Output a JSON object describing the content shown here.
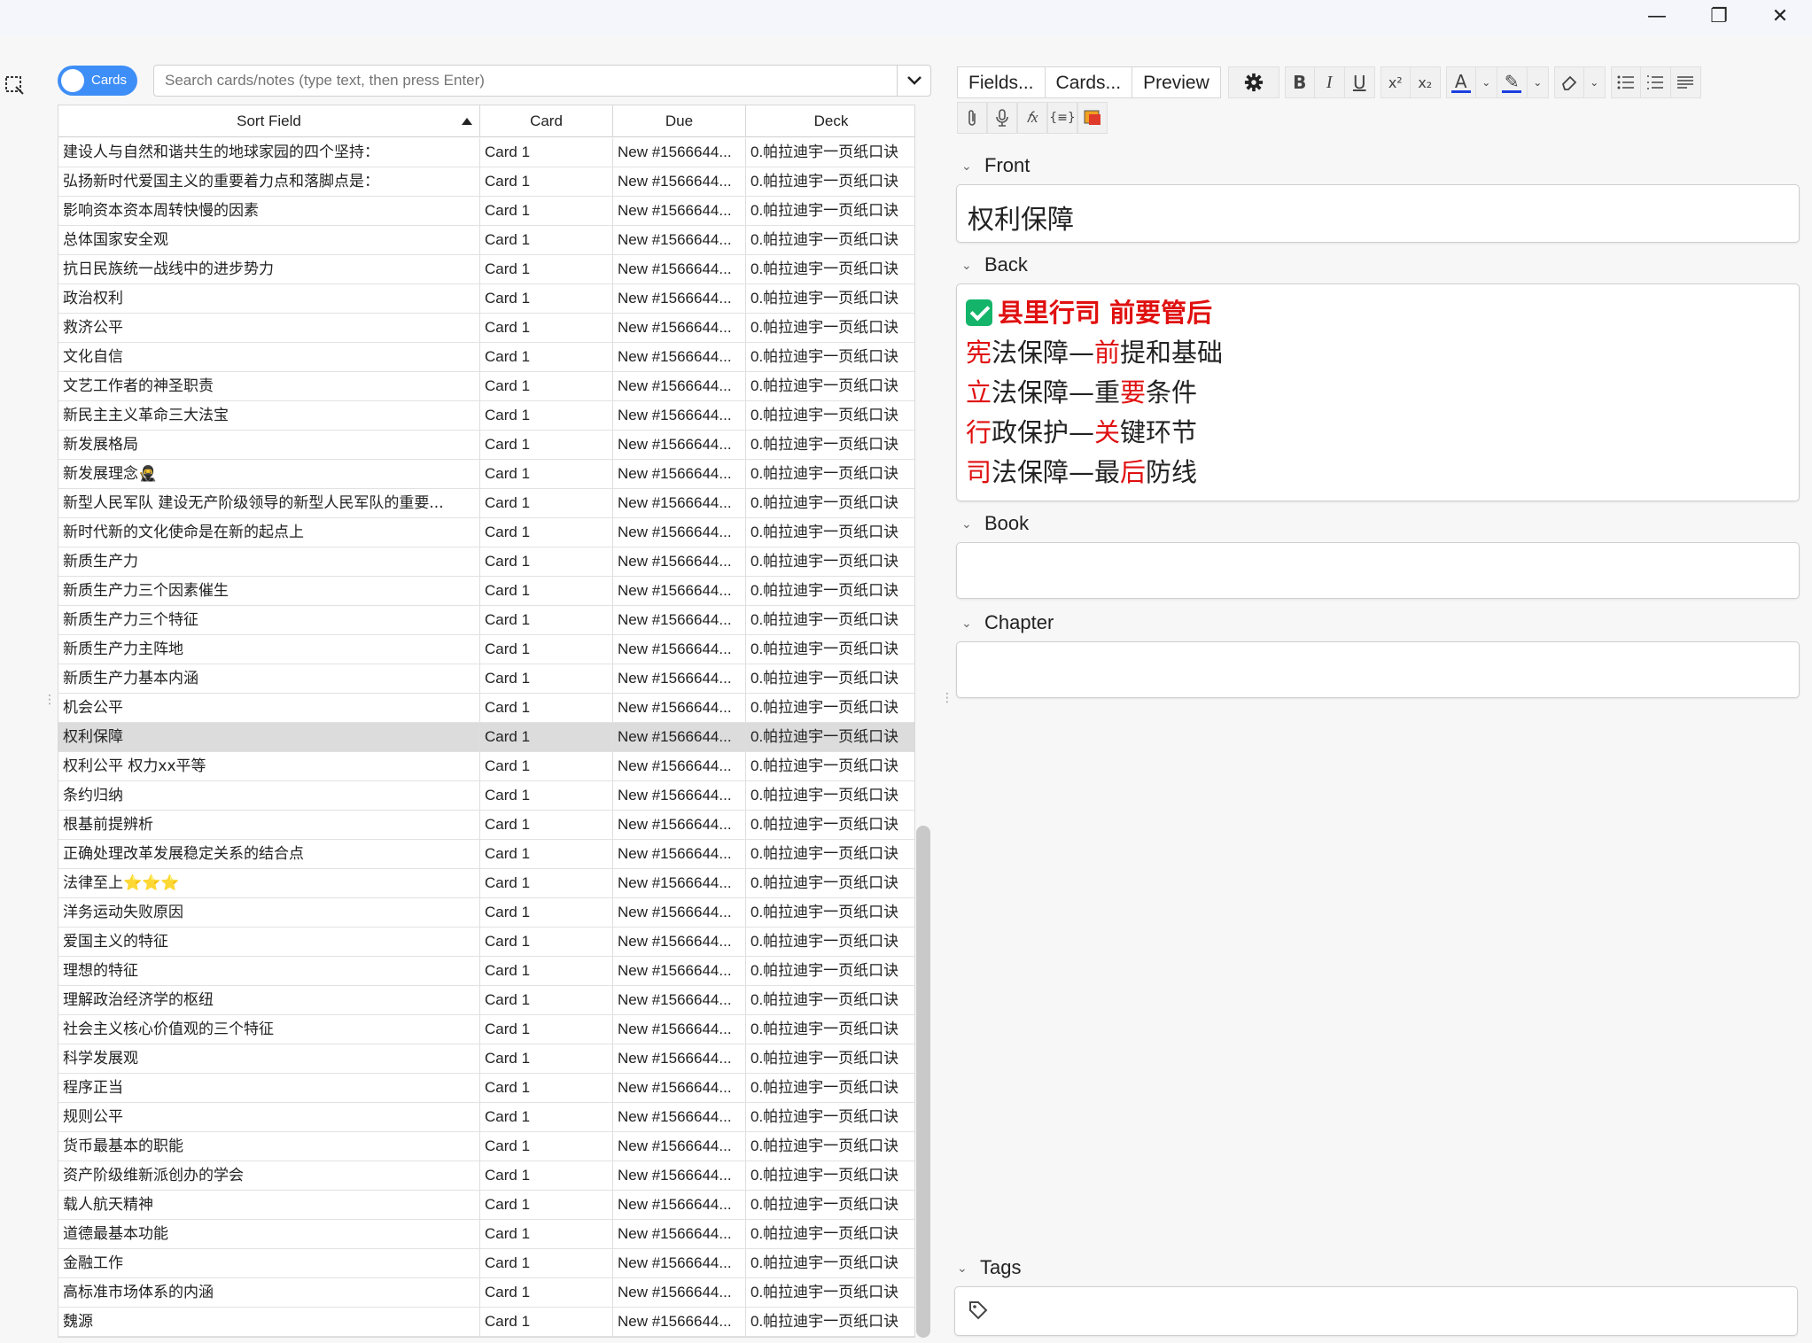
{
  "window": {
    "minimize": "—",
    "maximize": "❐",
    "close": "✕"
  },
  "toggle": {
    "label": "Cards"
  },
  "search": {
    "placeholder": "Search cards/notes (type text, then press Enter)"
  },
  "table": {
    "headers": [
      "Sort Field",
      "Card",
      "Due",
      "Deck"
    ],
    "rows": [
      [
        "建设人与自然和谐共生的地球家园的四个坚持：",
        "Card 1",
        "New #1566644...",
        "0.帕拉迪宇一页纸口诀"
      ],
      [
        "弘扬新时代爱国主义的重要着力点和落脚点是：",
        "Card 1",
        "New #1566644...",
        "0.帕拉迪宇一页纸口诀"
      ],
      [
        "影响资本资本周转快慢的因素",
        "Card 1",
        "New #1566644...",
        "0.帕拉迪宇一页纸口诀"
      ],
      [
        "总体国家安全观",
        "Card 1",
        "New #1566644...",
        "0.帕拉迪宇一页纸口诀"
      ],
      [
        "抗日民族统一战线中的进步势力",
        "Card 1",
        "New #1566644...",
        "0.帕拉迪宇一页纸口诀"
      ],
      [
        "政治权利",
        "Card 1",
        "New #1566644...",
        "0.帕拉迪宇一页纸口诀"
      ],
      [
        "救济公平",
        "Card 1",
        "New #1566644...",
        "0.帕拉迪宇一页纸口诀"
      ],
      [
        "文化自信",
        "Card 1",
        "New #1566644...",
        "0.帕拉迪宇一页纸口诀"
      ],
      [
        "文艺工作者的神圣职责",
        "Card 1",
        "New #1566644...",
        "0.帕拉迪宇一页纸口诀"
      ],
      [
        "新民主主义革命三大法宝",
        "Card 1",
        "New #1566644...",
        "0.帕拉迪宇一页纸口诀"
      ],
      [
        "新发展格局",
        "Card 1",
        "New #1566644...",
        "0.帕拉迪宇一页纸口诀"
      ],
      [
        "新发展理念🥷",
        "Card 1",
        "New #1566644...",
        "0.帕拉迪宇一页纸口诀"
      ],
      [
        "新型人民军队 建设无产阶级领导的新型人民军队的重要...",
        "Card 1",
        "New #1566644...",
        "0.帕拉迪宇一页纸口诀"
      ],
      [
        "新时代新的文化使命是在新的起点上",
        "Card 1",
        "New #1566644...",
        "0.帕拉迪宇一页纸口诀"
      ],
      [
        "新质生产力",
        "Card 1",
        "New #1566644...",
        "0.帕拉迪宇一页纸口诀"
      ],
      [
        "新质生产力三个因素催生",
        "Card 1",
        "New #1566644...",
        "0.帕拉迪宇一页纸口诀"
      ],
      [
        "新质生产力三个特征",
        "Card 1",
        "New #1566644...",
        "0.帕拉迪宇一页纸口诀"
      ],
      [
        "新质生产力主阵地",
        "Card 1",
        "New #1566644...",
        "0.帕拉迪宇一页纸口诀"
      ],
      [
        "新质生产力基本内涵",
        "Card 1",
        "New #1566644...",
        "0.帕拉迪宇一页纸口诀"
      ],
      [
        "机会公平",
        "Card 1",
        "New #1566644...",
        "0.帕拉迪宇一页纸口诀"
      ],
      [
        "权利保障",
        "Card 1",
        "New #1566644...",
        "0.帕拉迪宇一页纸口诀"
      ],
      [
        "权利公平 权力xx平等",
        "Card 1",
        "New #1566644...",
        "0.帕拉迪宇一页纸口诀"
      ],
      [
        "条约归纳",
        "Card 1",
        "New #1566644...",
        "0.帕拉迪宇一页纸口诀"
      ],
      [
        "根基前提辨析",
        "Card 1",
        "New #1566644...",
        "0.帕拉迪宇一页纸口诀"
      ],
      [
        "正确处理改革发展稳定关系的结合点",
        "Card 1",
        "New #1566644...",
        "0.帕拉迪宇一页纸口诀"
      ],
      [
        "法律至上⭐⭐⭐",
        "Card 1",
        "New #1566644...",
        "0.帕拉迪宇一页纸口诀"
      ],
      [
        "洋务运动失败原因",
        "Card 1",
        "New #1566644...",
        "0.帕拉迪宇一页纸口诀"
      ],
      [
        "爱国主义的特征",
        "Card 1",
        "New #1566644...",
        "0.帕拉迪宇一页纸口诀"
      ],
      [
        "理想的特征",
        "Card 1",
        "New #1566644...",
        "0.帕拉迪宇一页纸口诀"
      ],
      [
        "理解政治经济学的枢纽",
        "Card 1",
        "New #1566644...",
        "0.帕拉迪宇一页纸口诀"
      ],
      [
        "社会主义核心价值观的三个特征",
        "Card 1",
        "New #1566644...",
        "0.帕拉迪宇一页纸口诀"
      ],
      [
        "科学发展观",
        "Card 1",
        "New #1566644...",
        "0.帕拉迪宇一页纸口诀"
      ],
      [
        "程序正当",
        "Card 1",
        "New #1566644...",
        "0.帕拉迪宇一页纸口诀"
      ],
      [
        "规则公平",
        "Card 1",
        "New #1566644...",
        "0.帕拉迪宇一页纸口诀"
      ],
      [
        "货币最基本的职能",
        "Card 1",
        "New #1566644...",
        "0.帕拉迪宇一页纸口诀"
      ],
      [
        "资产阶级维新派创办的学会",
        "Card 1",
        "New #1566644...",
        "0.帕拉迪宇一页纸口诀"
      ],
      [
        "载人航天精神",
        "Card 1",
        "New #1566644...",
        "0.帕拉迪宇一页纸口诀"
      ],
      [
        "道德最基本功能",
        "Card 1",
        "New #1566644...",
        "0.帕拉迪宇一页纸口诀"
      ],
      [
        "金融工作",
        "Card 1",
        "New #1566644...",
        "0.帕拉迪宇一页纸口诀"
      ],
      [
        "高标准市场体系的内涵",
        "Card 1",
        "New #1566644...",
        "0.帕拉迪宇一页纸口诀"
      ],
      [
        "魏源",
        "Card 1",
        "New #1566644...",
        "0.帕拉迪宇一页纸口诀"
      ]
    ],
    "selected_row_index": 20
  },
  "editor": {
    "toolbar": {
      "fields": "Fields...",
      "cards": "Cards...",
      "preview": "Preview",
      "bold": "B",
      "italic": "I",
      "underline": "U",
      "superscript": "x²",
      "subscript": "x₂",
      "text_color": "A",
      "highlight": "✎",
      "eraser": "⌫",
      "function": "𝑓x",
      "cloze": "{≡}"
    },
    "fields": {
      "front": {
        "label": "Front",
        "value": "权利保障"
      },
      "back": {
        "label": "Back",
        "heading": "县里行司 前要管后",
        "lines": [
          {
            "red1": "宪",
            "t1": "法保障—",
            "red2": "前",
            "t2": "提和基础"
          },
          {
            "red1": "立",
            "t1": "法保障—重",
            "red2": "要",
            "t2": "条件"
          },
          {
            "red1": "行",
            "t1": "政保护—",
            "red2": "关",
            "t2": "键环节"
          },
          {
            "red1": "司",
            "t1": "法保障—最",
            "red2": "后",
            "t2": "防线"
          }
        ]
      },
      "book": {
        "label": "Book",
        "value": ""
      },
      "chapter": {
        "label": "Chapter",
        "value": ""
      }
    },
    "tags": {
      "label": "Tags"
    }
  },
  "colors": {
    "accent": "#3e8ef7",
    "highlight_red": "#e01010",
    "check_green": "#14b56a",
    "text_color_bar": "#1a3fe0"
  }
}
